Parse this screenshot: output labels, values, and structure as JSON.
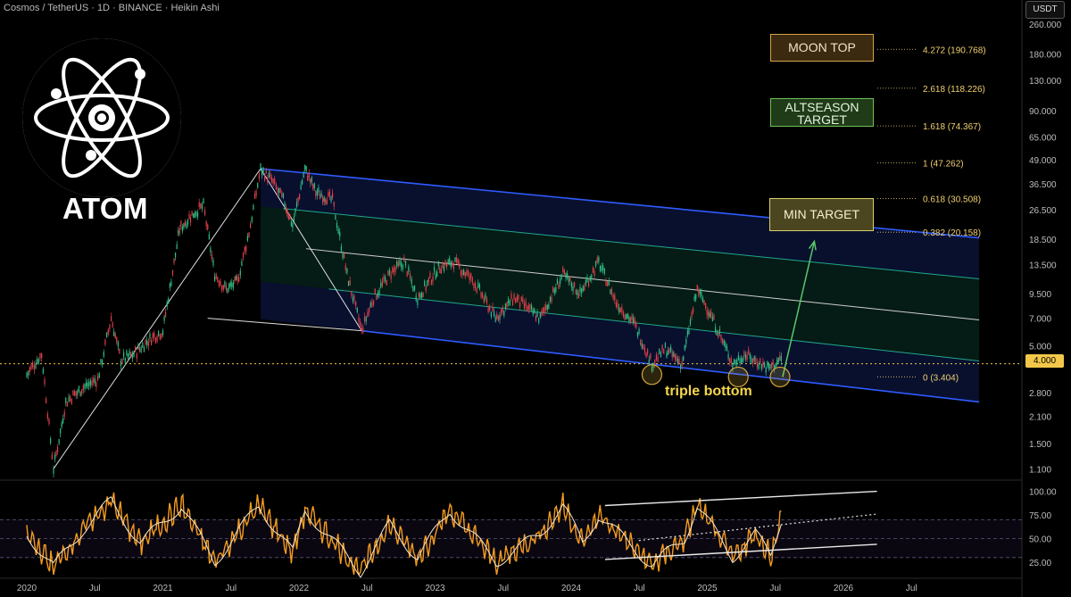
{
  "header": {
    "title": "Cosmos / TetherUS · 1D · BINANCE · Heikin Ashi"
  },
  "currency_badge": "USDT",
  "logo": {
    "text": "ATOM"
  },
  "annotations": {
    "moon_top": "MOON TOP",
    "altseason_line1": "ALTSEASON",
    "altseason_line2": "TARGET",
    "min_target": "MIN TARGET",
    "triple_bottom": "triple bottom"
  },
  "current_price": "4.000",
  "colors": {
    "channel_line": "#2f5bff",
    "channel_mid": "#20a88a",
    "fib_text": "#f0d070",
    "rsi_line": "#f39b1e",
    "current_price": "#f3c84a",
    "moon_border": "#d6a24b",
    "altseason_border": "#6fbf55",
    "min_border": "#d9d06a",
    "arrow": "#59c86a"
  },
  "chart_data": [
    {
      "type": "line",
      "x_ticks": [
        "2020",
        "Jul",
        "2021",
        "Jul",
        "2022",
        "Jul",
        "2023",
        "Jul",
        "2024",
        "Jul",
        "2025",
        "Jul",
        "2026",
        "Jul"
      ],
      "y_scale": "log",
      "y_ticks": [
        260,
        180,
        130,
        90,
        65,
        49,
        36.5,
        26.5,
        18.5,
        13.5,
        9.5,
        7,
        5,
        4,
        2.8,
        2.1,
        1.5,
        1.1
      ],
      "y_tick_labels": [
        "260.000",
        "180.000",
        "130.000",
        "90.000",
        "65.000",
        "49.000",
        "36.500",
        "26.500",
        "18.500",
        "13.500",
        "9.500",
        "7.000",
        "5.000",
        "4.000",
        "2.800",
        "2.100",
        "1.500",
        "1.100"
      ],
      "ylim": [
        1.0,
        300
      ],
      "fib_levels": [
        {
          "ratio": "4.272",
          "price": 190.768,
          "label": "4.272 (190.768)"
        },
        {
          "ratio": "2.618",
          "price": 118.226,
          "label": "2.618 (118.226)"
        },
        {
          "ratio": "1.618",
          "price": 74.367,
          "label": "1.618 (74.367)"
        },
        {
          "ratio": "1",
          "price": 47.262,
          "label": "1 (47.262)"
        },
        {
          "ratio": "0.618",
          "price": 30.508,
          "label": "0.618 (30.508)"
        },
        {
          "ratio": "0.382",
          "price": 20.158,
          "label": "0.382 (20.158)"
        },
        {
          "ratio": "0",
          "price": 3.404,
          "label": "0 (3.404)"
        }
      ],
      "price_series": [
        [
          "2020-01-01",
          3.5
        ],
        [
          "2020-02-10",
          4.5
        ],
        [
          "2020-03-13",
          1.1
        ],
        [
          "2020-04-15",
          2.5
        ],
        [
          "2020-06-01",
          3.0
        ],
        [
          "2020-07-10",
          3.3
        ],
        [
          "2020-08-15",
          7.0
        ],
        [
          "2020-09-10",
          4.2
        ],
        [
          "2020-10-15",
          4.5
        ],
        [
          "2020-12-01",
          5.5
        ],
        [
          "2021-01-01",
          6.0
        ],
        [
          "2021-02-15",
          21.0
        ],
        [
          "2021-03-20",
          25.0
        ],
        [
          "2021-04-20",
          28.0
        ],
        [
          "2021-05-20",
          12.0
        ],
        [
          "2021-06-20",
          10.0
        ],
        [
          "2021-07-20",
          11.0
        ],
        [
          "2021-08-20",
          20.0
        ],
        [
          "2021-09-20",
          44.0
        ],
        [
          "2021-10-20",
          38.0
        ],
        [
          "2021-11-20",
          30.0
        ],
        [
          "2021-12-15",
          22.0
        ],
        [
          "2022-01-17",
          44.0
        ],
        [
          "2022-02-15",
          33.0
        ],
        [
          "2022-04-01",
          30.0
        ],
        [
          "2022-05-10",
          12.0
        ],
        [
          "2022-06-18",
          6.0
        ],
        [
          "2022-07-20",
          9.0
        ],
        [
          "2022-09-01",
          12.0
        ],
        [
          "2022-10-10",
          14.0
        ],
        [
          "2022-11-15",
          9.0
        ],
        [
          "2023-01-10",
          13.0
        ],
        [
          "2023-02-20",
          14.0
        ],
        [
          "2023-04-15",
          11.0
        ],
        [
          "2023-06-12",
          7.0
        ],
        [
          "2023-08-01",
          9.0
        ],
        [
          "2023-10-10",
          7.0
        ],
        [
          "2023-12-10",
          12.0
        ],
        [
          "2024-01-25",
          9.5
        ],
        [
          "2024-03-15",
          14.0
        ],
        [
          "2024-05-01",
          8.5
        ],
        [
          "2024-06-20",
          6.5
        ],
        [
          "2024-08-05",
          4.0
        ],
        [
          "2024-09-10",
          4.8
        ],
        [
          "2024-10-25",
          4.0
        ],
        [
          "2024-12-05",
          10.0
        ],
        [
          "2025-01-15",
          7.0
        ],
        [
          "2025-03-10",
          4.0
        ],
        [
          "2025-04-10",
          4.5
        ],
        [
          "2025-06-15",
          3.8
        ],
        [
          "2025-07-22",
          4.3
        ]
      ],
      "channel": {
        "top_start": [
          "2021-09-20",
          44.0
        ],
        "top_end": [
          "2026-12-31",
          18.8
        ],
        "bottom_start": [
          "2022-06-18",
          6.0
        ],
        "bottom_end": [
          "2026-12-31",
          2.5
        ]
      },
      "projection": {
        "from": [
          "2025-07-22",
          3.4
        ],
        "to": [
          "2025-10-15",
          18.0
        ]
      },
      "triple_bottoms": [
        [
          "2024-08-05",
          3.5
        ],
        [
          "2025-03-25",
          3.4
        ],
        [
          "2025-07-15",
          3.4
        ]
      ]
    },
    {
      "type": "line",
      "y_ticks": [
        100,
        75,
        50,
        25
      ],
      "y_tick_labels": [
        "100.00",
        "75.00",
        "50.00",
        "25.00"
      ],
      "ylim": [
        10,
        110
      ],
      "levels": [
        70,
        50,
        30
      ],
      "trend_upper": [
        [
          "2024-04-01",
          85
        ],
        [
          "2026-04-01",
          100
        ]
      ],
      "trend_lower": [
        [
          "2024-04-01",
          28
        ],
        [
          "2026-04-01",
          44
        ]
      ],
      "trend_dotted": [
        [
          "2024-07-01",
          48
        ],
        [
          "2026-04-01",
          76
        ]
      ],
      "rsi_anchors": [
        [
          "2020-01-01",
          55
        ],
        [
          "2020-03-13",
          20
        ],
        [
          "2020-06-01",
          60
        ],
        [
          "2020-08-15",
          90
        ],
        [
          "2020-11-01",
          45
        ],
        [
          "2021-02-20",
          85
        ],
        [
          "2021-05-20",
          25
        ],
        [
          "2021-09-15",
          85
        ],
        [
          "2021-12-15",
          35
        ],
        [
          "2022-01-17",
          80
        ],
        [
          "2022-06-15",
          15
        ],
        [
          "2022-09-01",
          65
        ],
        [
          "2022-11-15",
          30
        ],
        [
          "2023-02-10",
          80
        ],
        [
          "2023-06-15",
          25
        ],
        [
          "2023-10-10",
          55
        ],
        [
          "2023-12-10",
          85
        ],
        [
          "2024-02-01",
          45
        ],
        [
          "2024-03-15",
          75
        ],
        [
          "2024-08-05",
          22
        ],
        [
          "2024-11-01",
          50
        ],
        [
          "2024-12-05",
          85
        ],
        [
          "2025-03-10",
          30
        ],
        [
          "2025-05-10",
          55
        ],
        [
          "2025-06-20",
          32
        ],
        [
          "2025-07-22",
          76
        ]
      ]
    }
  ]
}
